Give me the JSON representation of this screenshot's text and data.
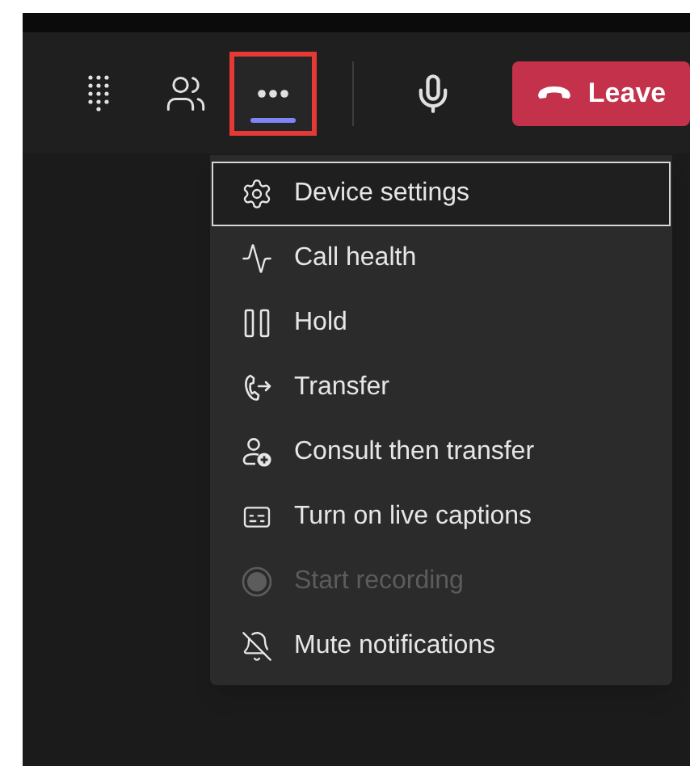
{
  "toolbar": {
    "buttons": [
      {
        "kind": "dialpad",
        "selected": false,
        "highlighted": false
      },
      {
        "kind": "people",
        "selected": false,
        "highlighted": false
      },
      {
        "kind": "more",
        "selected": true,
        "highlighted": true
      },
      {
        "kind": "mic",
        "selected": false,
        "highlighted": false
      }
    ],
    "leave_button": {
      "label": "Leave"
    }
  },
  "menu": {
    "items": [
      {
        "kind": "settings",
        "label": "Device settings",
        "focused": true,
        "disabled": false
      },
      {
        "kind": "health",
        "label": "Call health",
        "focused": false,
        "disabled": false
      },
      {
        "kind": "hold",
        "label": "Hold",
        "focused": false,
        "disabled": false
      },
      {
        "kind": "transfer",
        "label": "Transfer",
        "focused": false,
        "disabled": false
      },
      {
        "kind": "consult",
        "label": "Consult then transfer",
        "focused": false,
        "disabled": false
      },
      {
        "kind": "captions",
        "label": "Turn on live captions",
        "focused": false,
        "disabled": false
      },
      {
        "kind": "record",
        "label": "Start recording",
        "focused": false,
        "disabled": true
      },
      {
        "kind": "mute",
        "label": "Mute notifications",
        "focused": false,
        "disabled": false
      }
    ]
  }
}
